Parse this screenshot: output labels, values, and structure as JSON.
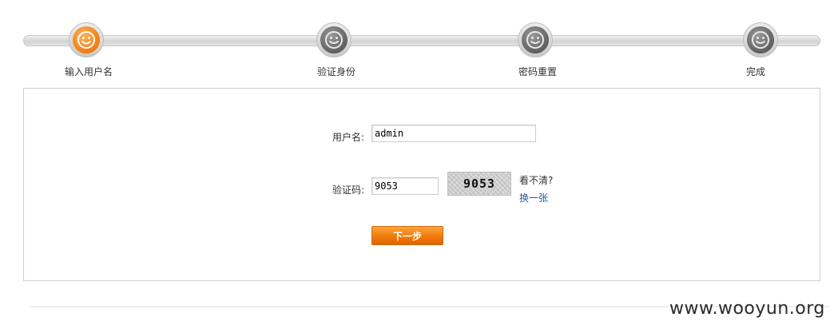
{
  "steps": [
    {
      "label": "输入用户名",
      "state": "active"
    },
    {
      "label": "验证身份",
      "state": "inactive"
    },
    {
      "label": "密码重置",
      "state": "inactive"
    },
    {
      "label": "完成",
      "state": "inactive"
    }
  ],
  "form": {
    "username_label": "用户名:",
    "username_value": "admin",
    "captcha_label": "验证码:",
    "captcha_value": "9053",
    "captcha_image_text": "9053",
    "refresh_hint": "看不清?",
    "refresh_link": "换一张",
    "next_button": "下一步"
  },
  "watermark": "www.wooyun.org",
  "colors": {
    "active_step": "#f27a12",
    "inactive_step": "#5b5b5b",
    "button": "#f07a0c",
    "link": "#1f5a9b"
  },
  "icons": {
    "step": "smiley-face-icon"
  }
}
